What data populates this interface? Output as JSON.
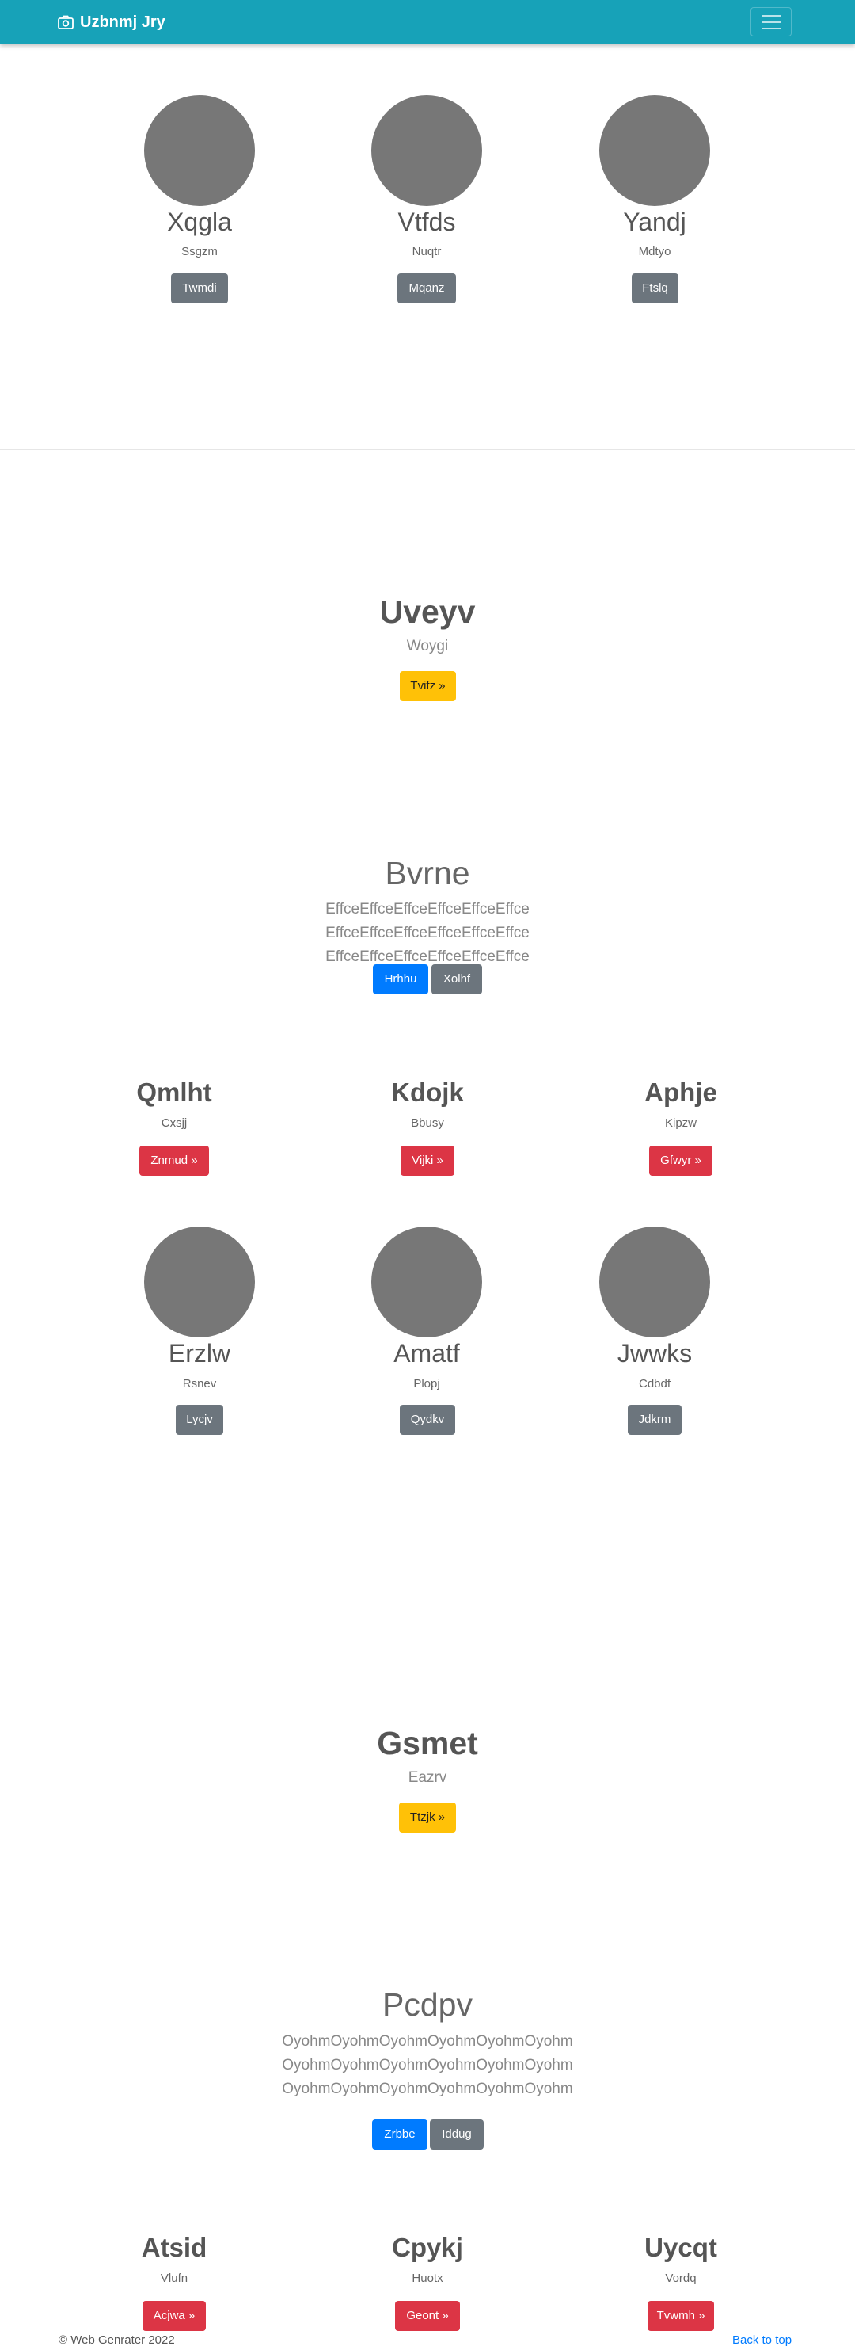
{
  "navbar": {
    "brand": "Uzbnmj Jry"
  },
  "row1": [
    {
      "name": "Xqgla",
      "sub": "Ssgzm",
      "button": "Twmdi"
    },
    {
      "name": "Vtfds",
      "sub": "Nuqtr",
      "button": "Mqanz"
    },
    {
      "name": "Yandj",
      "sub": "Mdtyo",
      "button": "Ftslq"
    }
  ],
  "hero1": {
    "title": "Uveyv",
    "sub": "Woygi",
    "button": "Tvifz »"
  },
  "lead1": {
    "title": "Bvrne",
    "text": "EffceEffceEffceEffceEffceEffce EffceEffceEffceEffceEffceEffce EffceEffceEffceEffceEffceEffce",
    "primary": "Hrhhu",
    "secondary": "Xolhf"
  },
  "row2": [
    {
      "title": "Qmlht",
      "sub": "Cxsjj",
      "button": "Znmud »"
    },
    {
      "title": "Kdojk",
      "sub": "Bbusy",
      "button": "Vijki »"
    },
    {
      "title": "Aphje",
      "sub": "Kipzw",
      "button": "Gfwyr »"
    }
  ],
  "row3": [
    {
      "name": "Erzlw",
      "sub": "Rsnev",
      "button": "Lycjv"
    },
    {
      "name": "Amatf",
      "sub": "Plopj",
      "button": "Qydkv"
    },
    {
      "name": "Jwwks",
      "sub": "Cdbdf",
      "button": "Jdkrm"
    }
  ],
  "hero2": {
    "title": "Gsmet",
    "sub": "Eazrv",
    "button": "Ttzjk »"
  },
  "lead2": {
    "title": "Pcdpv",
    "text": "OyohmOyohmOyohmOyohmOyohmOyohm OyohmOyohmOyohmOyohmOyohmOyohm OyohmOyohmOyohmOyohmOyohmOyohm",
    "primary": "Zrbbe",
    "secondary": "Iddug"
  },
  "row4": [
    {
      "title": "Atsid",
      "sub": "Vlufn",
      "button": "Acjwa »"
    },
    {
      "title": "Cpykj",
      "sub": "Huotx",
      "button": "Geont »"
    },
    {
      "title": "Uycqt",
      "sub": "Vordq",
      "button": "Tvwmh »"
    }
  ],
  "footer": {
    "copyright": "© Web Genrater 2022",
    "back_to_top": "Back to top"
  },
  "colors": {
    "navbar": "#17a2b8",
    "avatar": "#777777",
    "danger": "#dc3545",
    "warning": "#ffc107",
    "primary": "#007bff",
    "secondary": "#6c757d"
  },
  "icons": {
    "brand": "camera-icon",
    "toggler": "hamburger-icon"
  }
}
